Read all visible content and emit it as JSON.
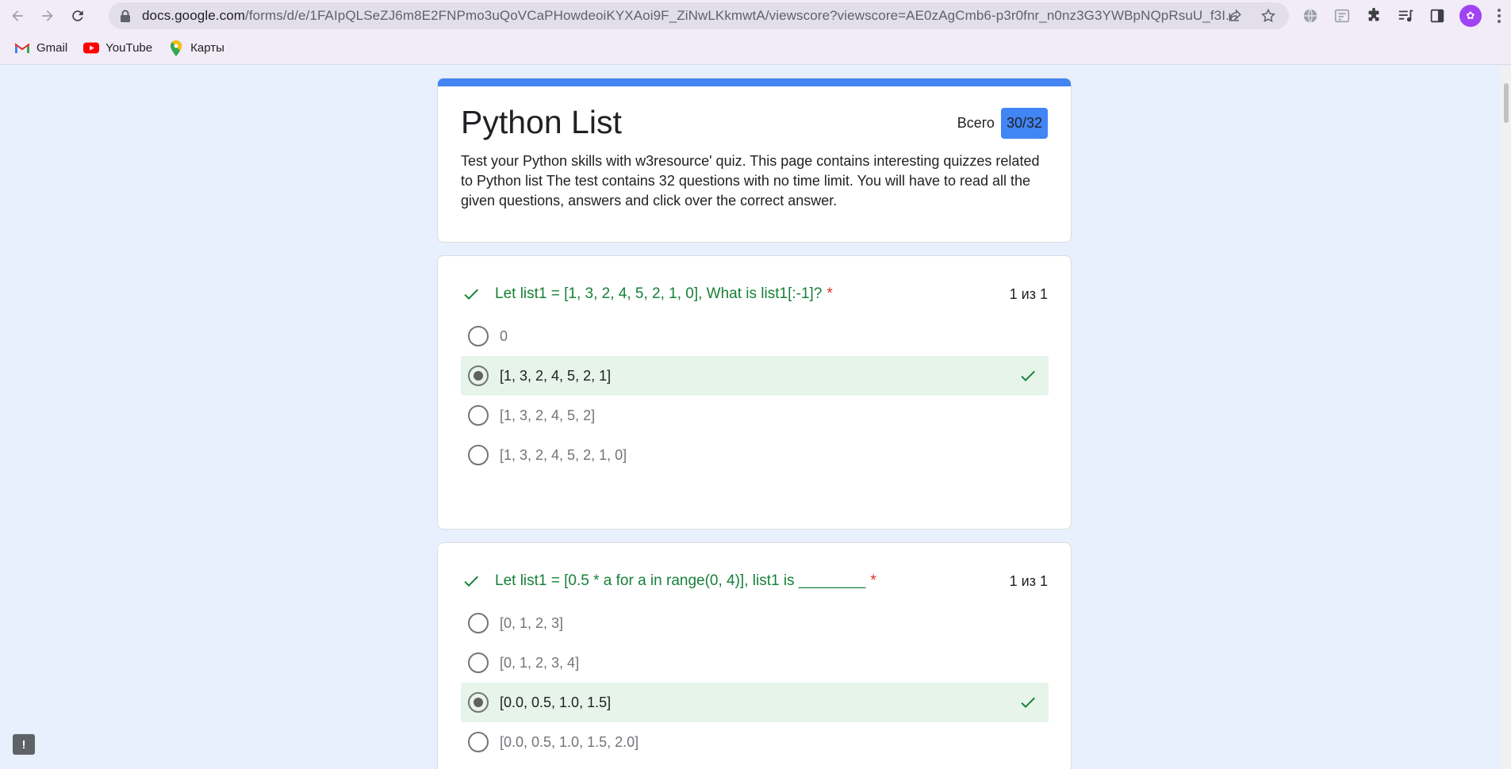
{
  "browser": {
    "url_host": "docs.google.com",
    "url_path": "/forms/d/e/1FAIpQLSeZJ6m8E2FNPmo3uQoVCaPHowdeoiKYXAoi9F_ZiNwLKkmwtA/viewscore?viewscore=AE0zAgCmb6-p3r0fnr_n0nz3G3YWBpNQpRsuU_f3I...",
    "bookmarks": [
      {
        "label": "Gmail"
      },
      {
        "label": "YouTube"
      },
      {
        "label": "Карты"
      }
    ],
    "avatar_letter": "✿"
  },
  "form": {
    "title": "Python List",
    "score_label": "Всего",
    "score_value": "30/32",
    "description": "Test your Python skills with w3resource' quiz. This page contains interesting quizzes related to Python list The test contains 32 questions with no time limit. You will have to read all the given questions, answers and click over the correct answer.",
    "accent_color": "#4285f4"
  },
  "questions": [
    {
      "text": "Let list1 = [1, 3, 2, 4, 5, 2, 1, 0], What is list1[:-1]?",
      "required": "*",
      "points": "1 из 1",
      "options": [
        {
          "label": "0",
          "selected": false,
          "correct": false
        },
        {
          "label": "[1, 3, 2, 4, 5, 2, 1]",
          "selected": true,
          "correct": true
        },
        {
          "label": "[1, 3, 2, 4, 5, 2]",
          "selected": false,
          "correct": false
        },
        {
          "label": "[1, 3, 2, 4, 5, 2, 1, 0]",
          "selected": false,
          "correct": false
        }
      ]
    },
    {
      "text": "Let list1 = [0.5 * a for a in range(0, 4)], list1 is ________",
      "required": "*",
      "points": "1 из 1",
      "options": [
        {
          "label": "[0, 1, 2, 3]",
          "selected": false,
          "correct": false
        },
        {
          "label": "[0, 1, 2, 3, 4]",
          "selected": false,
          "correct": false
        },
        {
          "label": "[0.0, 0.5, 1.0, 1.5]",
          "selected": true,
          "correct": true
        },
        {
          "label": "[0.0, 0.5, 1.0, 1.5, 2.0]",
          "selected": false,
          "correct": false
        }
      ]
    }
  ],
  "feedback_icon": "!"
}
